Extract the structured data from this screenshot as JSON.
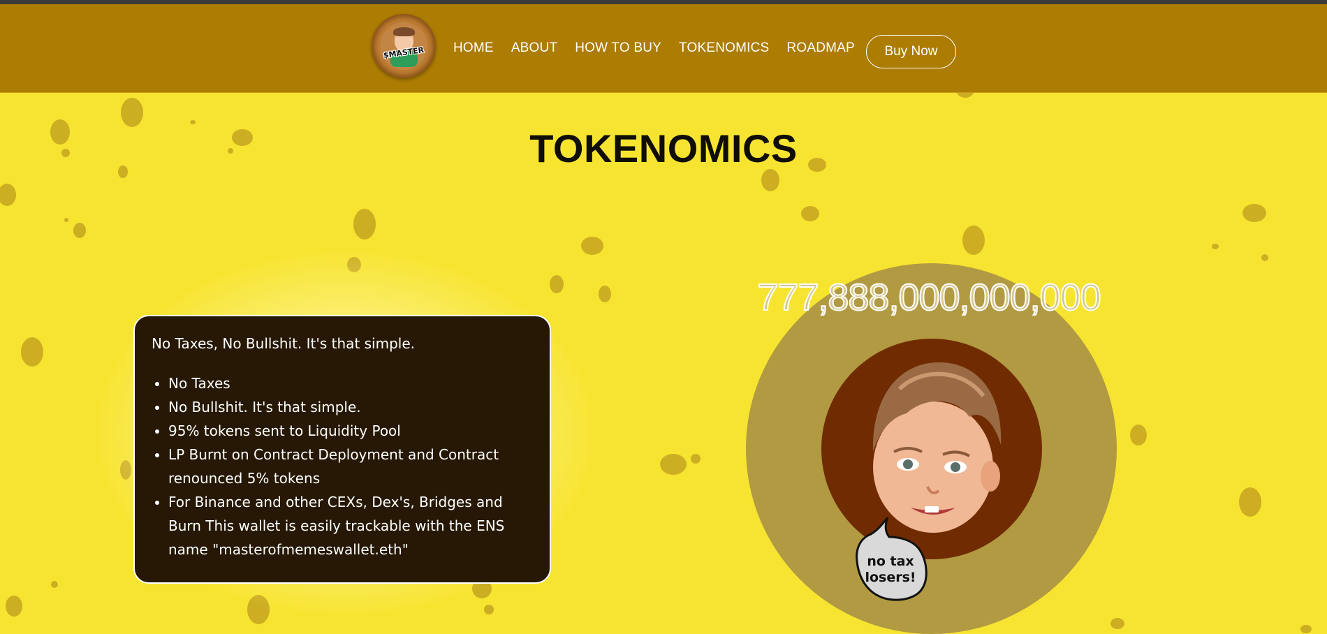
{
  "brand": {
    "logo_text": "$MASTER"
  },
  "nav": {
    "links": [
      "HOME",
      "ABOUT",
      "HOW TO BUY",
      "TOKENOMICS",
      "ROADMAP"
    ],
    "cta_label": "Buy Now"
  },
  "tokenomics": {
    "title": "TOKENOMICS",
    "intro": "No Taxes, No Bullshit. It's that simple.",
    "points": [
      "No Taxes",
      "No Bullshit. It's that simple.",
      "95% tokens sent to Liquidity Pool",
      "LP Burnt on Contract Deployment and Contract renounced 5% tokens",
      "For Binance and other CEXs, Dex's, Bridges and Burn This wallet is easily trackable with the ENS name \"masterofmemeswallet.eth\""
    ],
    "total_supply": "777,888,000,000,000",
    "speech_bubble": [
      "no tax",
      "losers!"
    ]
  },
  "colors": {
    "nav_bg": "#ac7c03",
    "page_bg": "#f7e431",
    "spot": "#c5a520",
    "info_box_bg": "#261805",
    "outer_circle": "#b19a42",
    "inner_circle": "#702c00"
  },
  "icons": [
    "mascot-logo-icon",
    "baby-mascot-icon",
    "speech-bubble-icon"
  ]
}
